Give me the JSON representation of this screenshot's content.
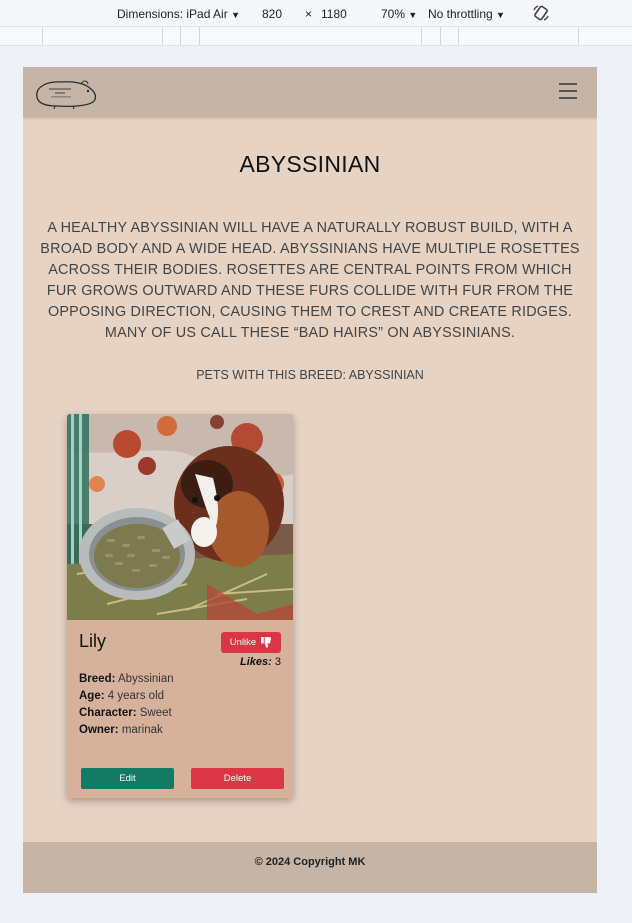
{
  "devtools": {
    "dimensions_label": "Dimensions: iPad Air",
    "width": "820",
    "times": "×",
    "height": "1180",
    "zoom": "70%",
    "throttling": "No throttling",
    "rotate_icon": "rotate-icon"
  },
  "navbar": {
    "logo_icon": "guinea-pig-logo",
    "menu_icon": "hamburger-menu-icon"
  },
  "page": {
    "title": "ABYSSINIAN",
    "description": "A healthy Abyssinian will have a naturally robust build, with a broad body and a wide head. Abyssinians have multiple rosettes across their bodies. Rosettes are central points from which fur grows outward and these furs collide with fur from the opposing direction, causing them to crest and create ridges. Many of us call these “bad hairs” on Abyssinians.",
    "pets_heading": "PETS WITH THIS BREED: ABYSSINIAN"
  },
  "card": {
    "name": "Lily",
    "unlike_label": "Unlike",
    "likes_label": "Likes:",
    "likes_count": "3",
    "breed_label": "Breed:",
    "breed": "Abyssinian",
    "age_label": "Age:",
    "age": "4 years old",
    "character_label": "Character:",
    "character": "Sweet",
    "owner_label": "Owner:",
    "owner": "marinak",
    "edit_label": "Edit",
    "delete_label": "Delete"
  },
  "footer": {
    "copyright": "© 2024 Copyright MK"
  },
  "colors": {
    "page_bg": "#e6d3c4",
    "navbar_bg": "#c6b5a6",
    "card_bg": "#d6b29d",
    "danger": "#dc3545",
    "success": "#137a63"
  }
}
